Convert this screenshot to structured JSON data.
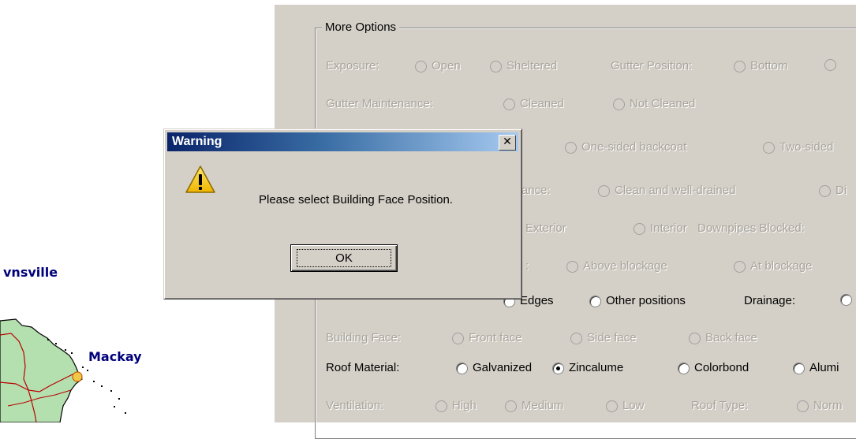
{
  "map": {
    "cities": [
      {
        "label": "vnsville"
      },
      {
        "label": "Mackay"
      }
    ]
  },
  "options_group": {
    "title": "More Options",
    "rows": [
      {
        "items": [
          {
            "type": "label",
            "text": "Exposure:"
          },
          {
            "type": "radio",
            "text": "Open",
            "checked": false
          },
          {
            "type": "radio",
            "text": "Sheltered",
            "checked": false
          },
          {
            "type": "label",
            "text": "Gutter Position:"
          },
          {
            "type": "radio",
            "text": "Bottom",
            "checked": false
          },
          {
            "type": "radio",
            "text": "",
            "checked": false
          }
        ]
      },
      {
        "items": [
          {
            "type": "label",
            "text": "Gutter Maintenance:"
          },
          {
            "type": "radio",
            "text": "Cleaned",
            "checked": false
          },
          {
            "type": "radio",
            "text": "Not Cleaned",
            "checked": false
          }
        ]
      },
      {
        "items": [
          {
            "type": "radio",
            "text": "One-sided backcoat",
            "checked": false
          },
          {
            "type": "radio",
            "text": "Two-sided",
            "checked": false
          }
        ]
      },
      {
        "items": [
          {
            "type": "label",
            "text": "ance:"
          },
          {
            "type": "radio",
            "text": "Clean and well-drained",
            "checked": false
          },
          {
            "type": "radio",
            "text": "Di",
            "checked": false
          }
        ]
      },
      {
        "items": [
          {
            "type": "label",
            "text": "Exterior"
          },
          {
            "type": "radio",
            "text": "Interior",
            "checked": false
          },
          {
            "type": "label",
            "text": "Downpipes Blocked:"
          }
        ]
      },
      {
        "items": [
          {
            "type": "label",
            "text": ":"
          },
          {
            "type": "radio",
            "text": "Above blockage",
            "checked": false
          },
          {
            "type": "radio",
            "text": "At blockage",
            "checked": false
          }
        ]
      },
      {
        "items": [
          {
            "type": "radio",
            "text": "Edges",
            "checked": false
          },
          {
            "type": "radio",
            "text": "Other positions",
            "checked": false
          },
          {
            "type": "label",
            "text": "Drainage:"
          },
          {
            "type": "radio",
            "text": "",
            "checked": false
          }
        ]
      },
      {
        "items": [
          {
            "type": "label",
            "text": "Building Face:"
          },
          {
            "type": "radio",
            "text": "Front face",
            "checked": false
          },
          {
            "type": "radio",
            "text": "Side face",
            "checked": false
          },
          {
            "type": "radio",
            "text": "Back face",
            "checked": false
          }
        ]
      },
      {
        "items": [
          {
            "type": "label",
            "text": "Roof Material:"
          },
          {
            "type": "radio",
            "text": "Galvanized",
            "checked": false
          },
          {
            "type": "radio",
            "text": "Zincalume",
            "checked": true
          },
          {
            "type": "radio",
            "text": "Colorbond",
            "checked": false
          },
          {
            "type": "radio",
            "text": "Alumi",
            "checked": false
          }
        ]
      },
      {
        "items": [
          {
            "type": "label",
            "text": "Ventilation:"
          },
          {
            "type": "radio",
            "text": "High",
            "checked": false
          },
          {
            "type": "radio",
            "text": "Medium",
            "checked": false
          },
          {
            "type": "radio",
            "text": "Low",
            "checked": false
          },
          {
            "type": "label",
            "text": "Roof Type:"
          },
          {
            "type": "radio",
            "text": "Norm",
            "checked": false
          }
        ]
      }
    ]
  },
  "dialog": {
    "title": "Warning",
    "close_glyph": "✕",
    "message": "Please select Building Face Position.",
    "ok_label": "OK",
    "icon": "warning-icon"
  },
  "colors": {
    "panel_bg": "#d4d0c8",
    "disabled_text": "#a8a49b",
    "title_gradient_start": "#0a246a",
    "title_gradient_end": "#a6caf0",
    "map_land": "#b4e0b0",
    "city_label": "#00007a"
  }
}
